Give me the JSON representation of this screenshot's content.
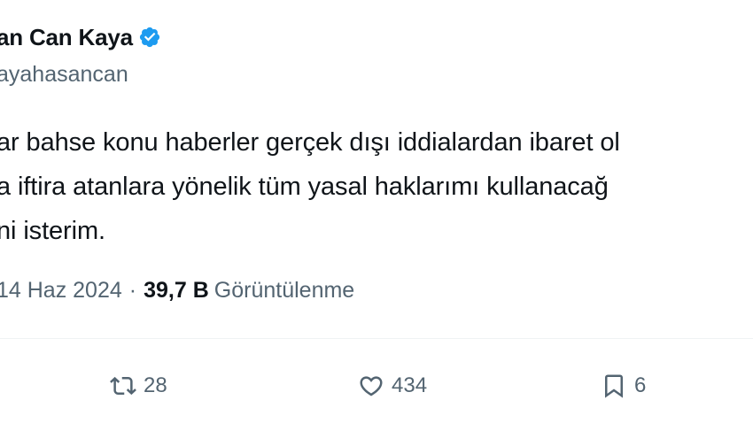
{
  "author": {
    "display_name": "an Can Kaya",
    "handle": "ayahasancan",
    "verified_icon": "verified-badge-icon",
    "verified_color": "#1d9bf0"
  },
  "tweet": {
    "lines": [
      "ar bahse konu haberler gerçek dışı iddialardan ibaret ol",
      "a iftira atanlara yönelik tüm yasal haklarımı kullanacağ",
      "ni isterim."
    ]
  },
  "meta": {
    "date": "14 Haz 2024",
    "separator": "·",
    "views_count": "39,7 B",
    "views_label": "Görüntülenme"
  },
  "actions": {
    "retweet": {
      "icon": "retweet-icon",
      "count": "28"
    },
    "like": {
      "icon": "heart-icon",
      "count": "434"
    },
    "bookmark": {
      "icon": "bookmark-icon",
      "count": "6"
    }
  },
  "colors": {
    "text": "#0f1419",
    "secondary": "#536471",
    "accent": "#1d9bf0"
  }
}
